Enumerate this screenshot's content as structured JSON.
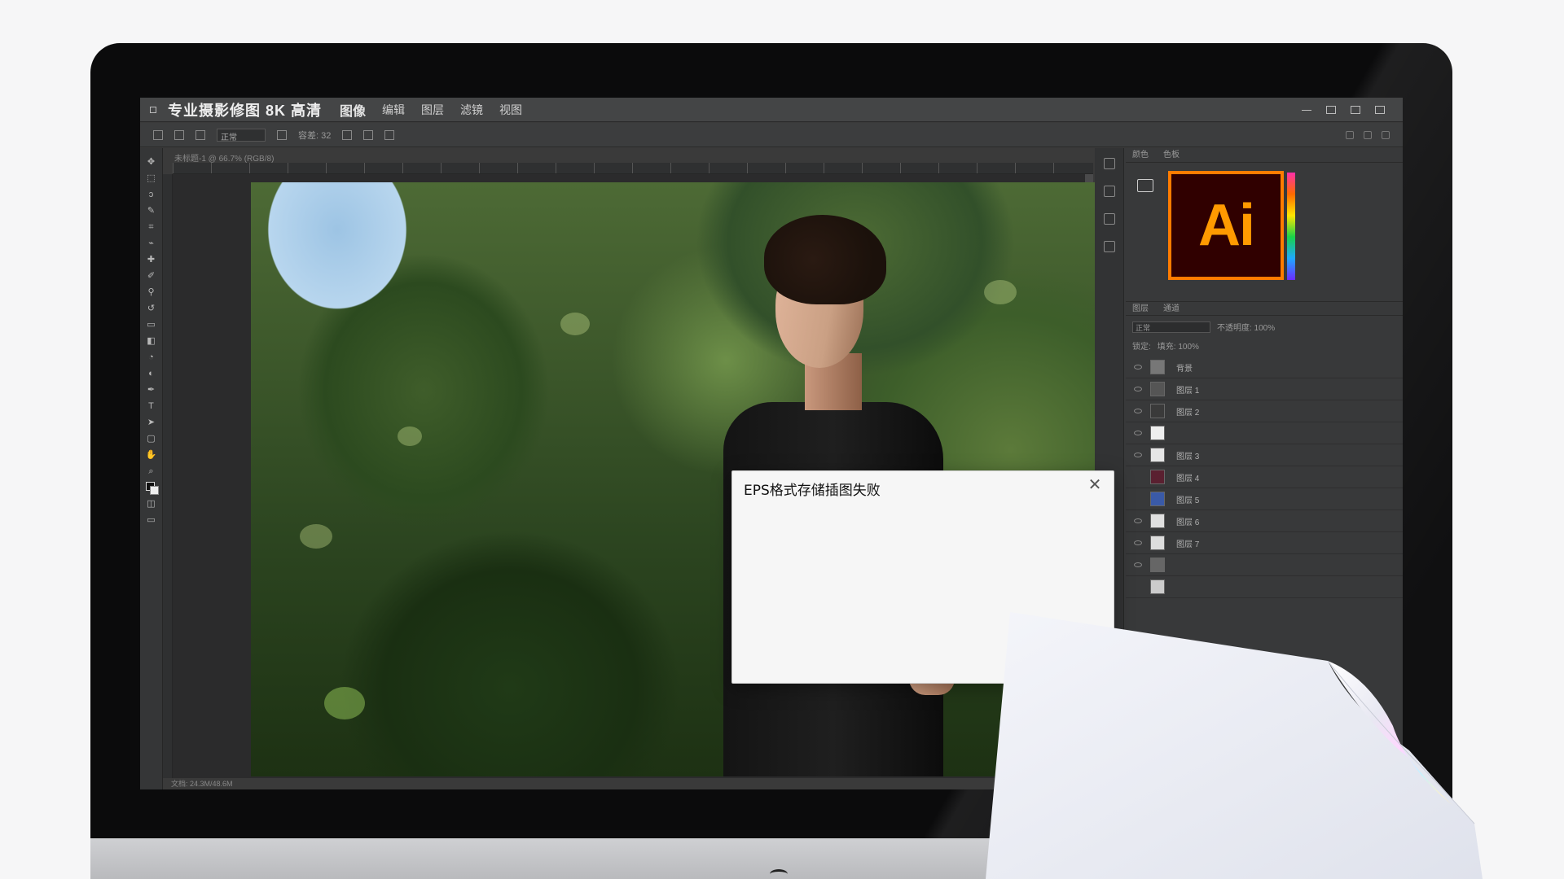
{
  "app": {
    "title": "专业摄影修图 8K 高清",
    "menus": [
      "图像",
      "编辑",
      "图层",
      "滤镜",
      "视图"
    ]
  },
  "options_bar": {
    "mode_box": "正常",
    "tolerance": "容差: 32"
  },
  "document": {
    "tab": "未标题-1 @ 66.7% (RGB/8)",
    "status": "文档: 24.3M/48.6M"
  },
  "panels": {
    "top_tabs": [
      "颜色",
      "色板"
    ],
    "layer_tabs": [
      "图层",
      "通道"
    ],
    "blend_mode": "正常",
    "opacity_label": "不透明度: 100%",
    "fill_label": "填充: 100%",
    "lock_label": "锁定:",
    "layers": [
      {
        "label": "背景",
        "eye": true,
        "thumb": "#777777"
      },
      {
        "label": "图层 1",
        "eye": true,
        "thumb": "#555555"
      },
      {
        "label": "图层 2",
        "eye": true,
        "thumb": "#3a3a3a"
      },
      {
        "label": "",
        "eye": true,
        "thumb": "#eeeeee"
      },
      {
        "label": "图层 3",
        "eye": true,
        "thumb": "#e6e6e6"
      },
      {
        "label": "图层 4",
        "eye": false,
        "thumb": "#5a2030"
      },
      {
        "label": "图层 5",
        "eye": false,
        "thumb": "#3a5aa8"
      },
      {
        "label": "图层 6",
        "eye": true,
        "thumb": "#e0e0e0"
      },
      {
        "label": "图层 7",
        "eye": true,
        "thumb": "#dddddd"
      },
      {
        "label": "",
        "eye": true,
        "thumb": "#666666"
      },
      {
        "label": "",
        "eye": false,
        "thumb": "#cccccc"
      }
    ]
  },
  "ai_logo_text": "Ai",
  "dialog": {
    "title": "EPS格式存储插图失败",
    "close_glyph": "✕"
  },
  "colors": {
    "ai_orange": "#ff7c00",
    "ai_bg": "#300000",
    "dialog_bg": "#f6f6f6"
  }
}
